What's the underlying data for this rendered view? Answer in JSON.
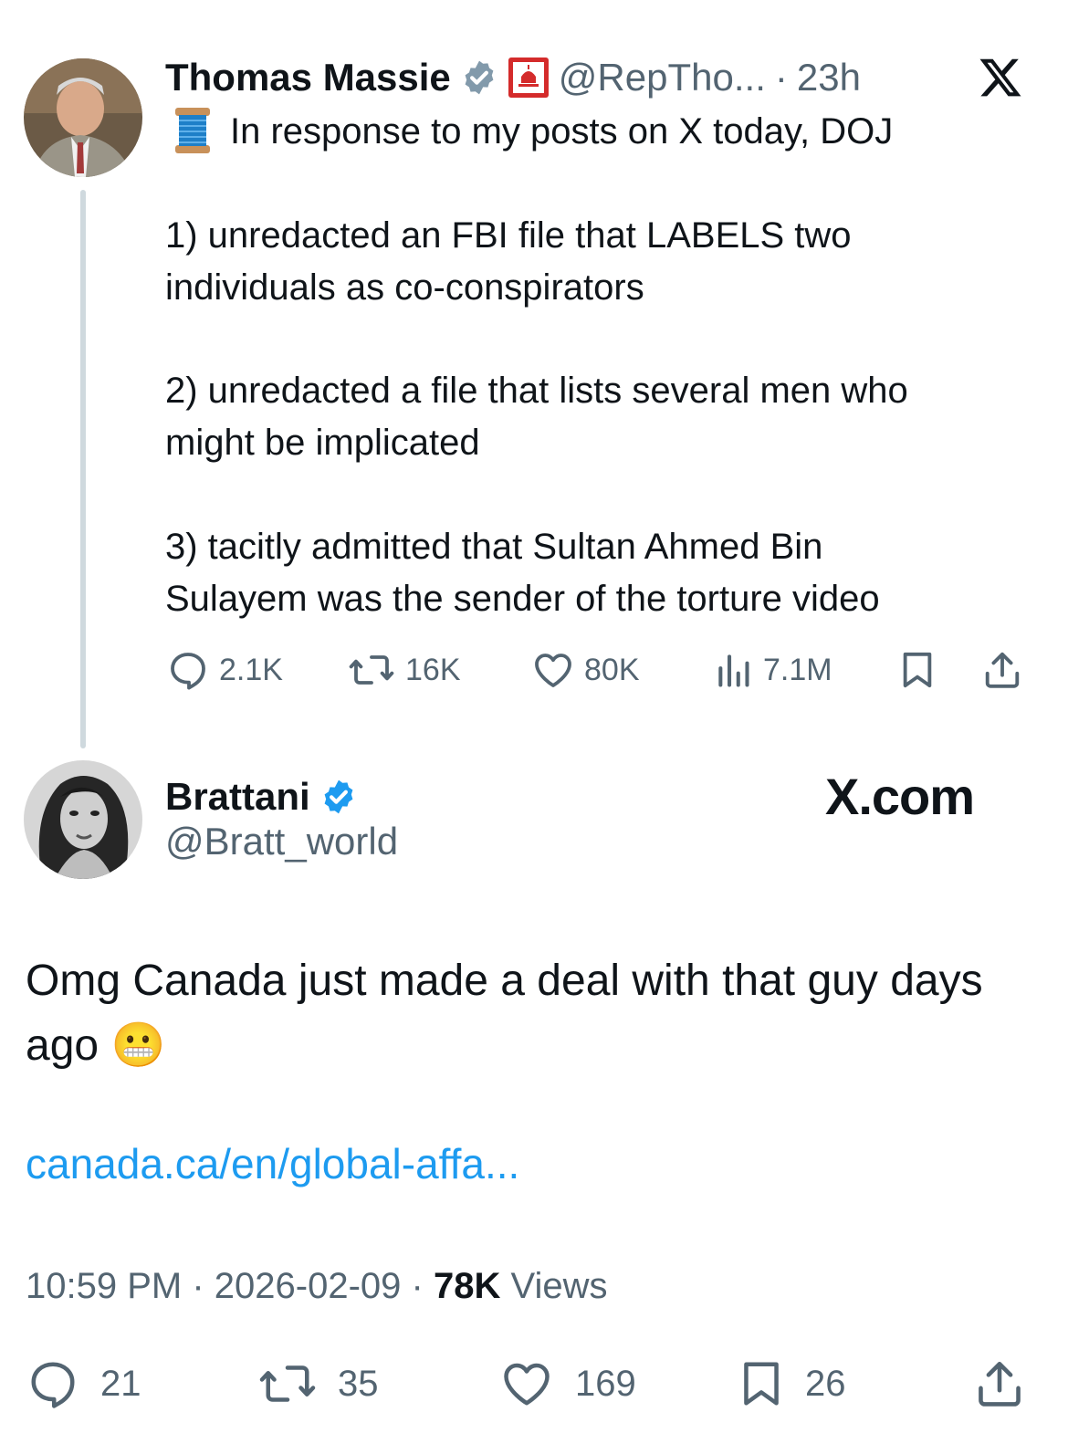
{
  "quoted_tweet": {
    "author_name": "Thomas Massie",
    "handle": "@RepTho...",
    "separator": "·",
    "time": "23h",
    "lines": [
      "In response to my posts on X today, DOJ",
      "1) unredacted an FBI file that LABELS two",
      "individuals as co-conspirators",
      "2) unredacted a file that lists several men who",
      "might be implicated",
      "3) tacitly admitted that Sultan Ahmed Bin",
      "Sulayem was the sender of the torture video"
    ],
    "stats": {
      "replies": "2.1K",
      "reposts": "16K",
      "likes": "80K",
      "views": "7.1M"
    },
    "icons": [
      "spool-of-thread-icon",
      "verified-badge-icon",
      "gop-capitol-icon",
      "x-logo-icon"
    ]
  },
  "main_tweet": {
    "author_name": "Brattani",
    "handle": "@Bratt_world",
    "watermark": "X.com",
    "text": "Omg Canada just made a deal with that guy days ago",
    "emoji": "😬",
    "link": "canada.ca/en/global-affa...",
    "time": "10:59 PM",
    "date": "2026-02-09",
    "sep1": "·",
    "sep2": "·",
    "views_count": "78K",
    "views_label": "Views",
    "stats": {
      "replies": "21",
      "reposts": "35",
      "likes": "169",
      "bookmarks": "26"
    }
  },
  "colors": {
    "link": "#1d9bf0",
    "verified": "#1d9bf0",
    "gov_badge": "#829aab",
    "muted": "#536471",
    "thread_line": "#cfd9de"
  }
}
